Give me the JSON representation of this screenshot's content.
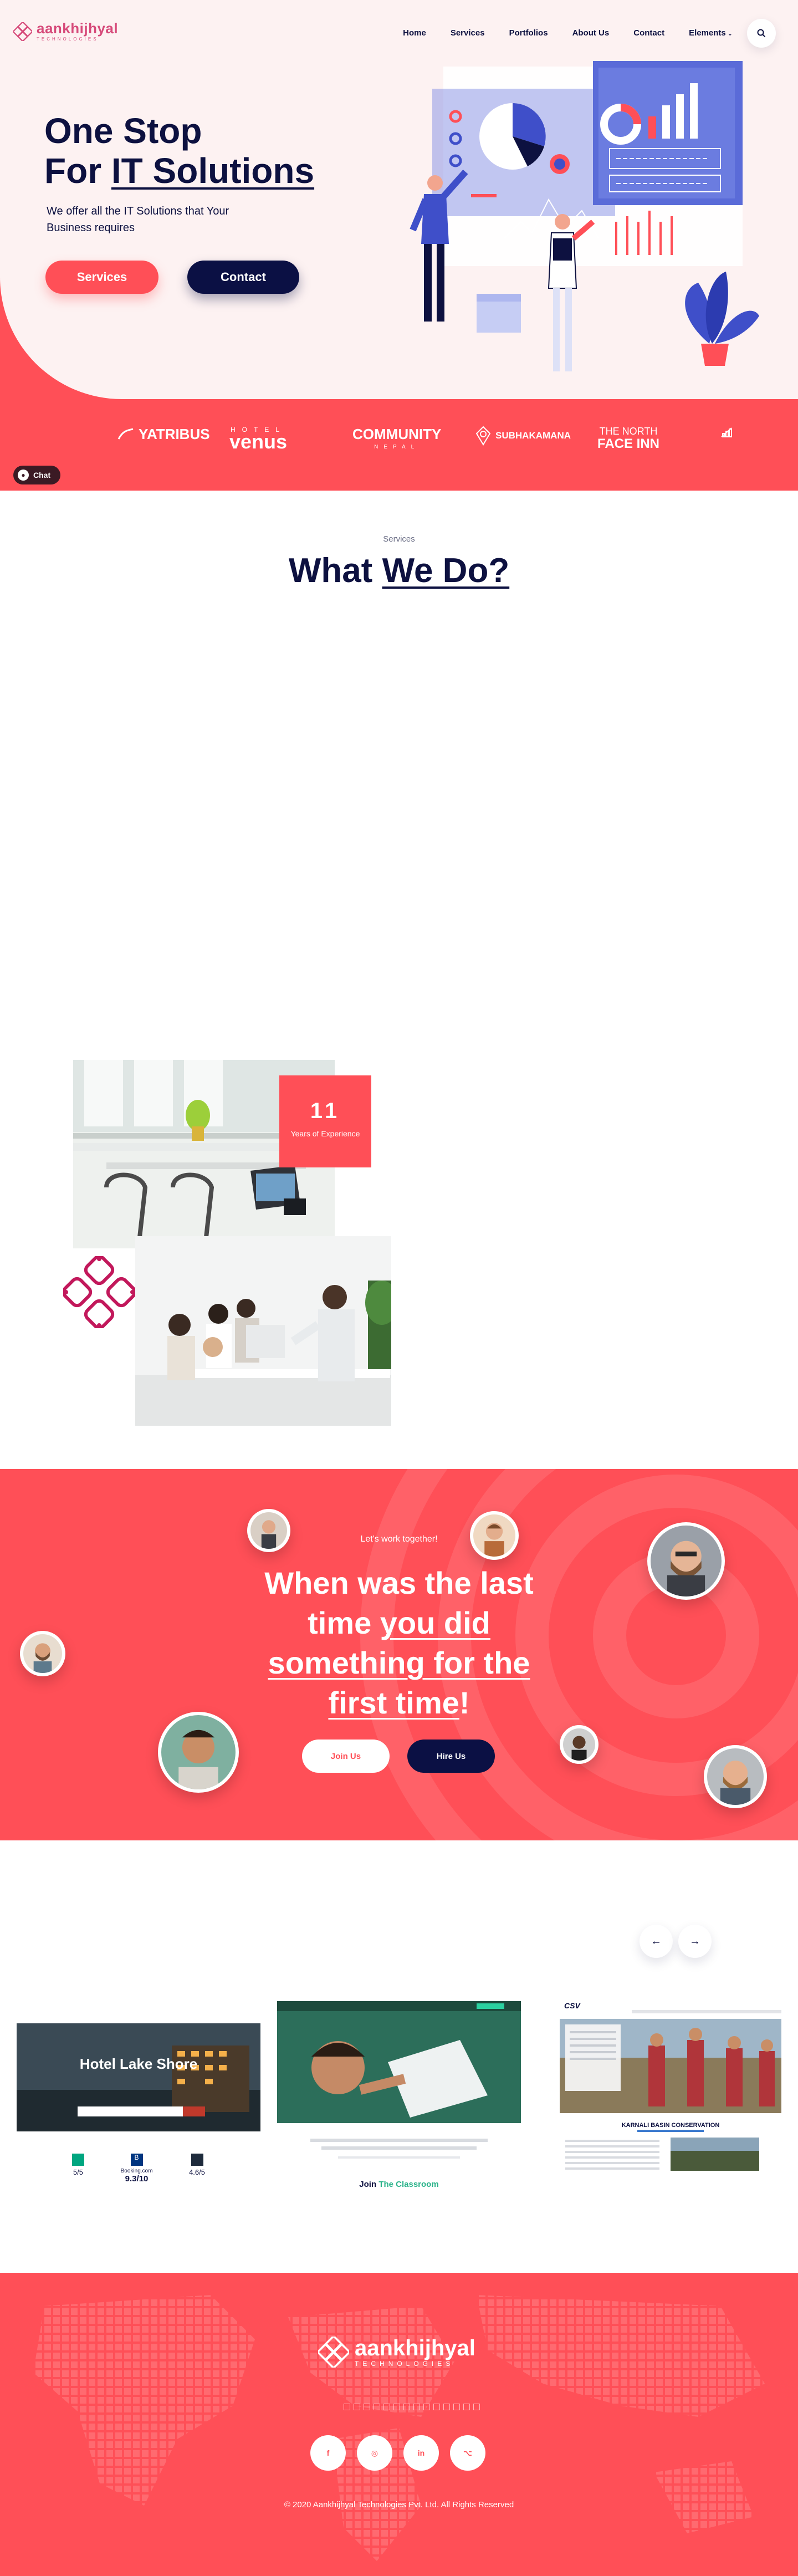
{
  "brand": {
    "name": "aankhijhyal",
    "tagline": "TECHNOLOGIES",
    "colors": {
      "primary": "#ff4f57",
      "navy": "#0b1044",
      "pink": "#d64a7a",
      "hero_bg": "#fdf2f2"
    }
  },
  "nav": {
    "items": [
      "Home",
      "Services",
      "Portfolios",
      "About Us",
      "Contact",
      "Elements"
    ],
    "search_icon": "search-icon"
  },
  "hero": {
    "title_line1": "One Stop",
    "title_line2_prefix": "For ",
    "title_line2_underlined": "IT Solutions",
    "description": "We offer all the IT Solutions that Your Business requires",
    "services_button": "Services",
    "contact_button": "Contact"
  },
  "partners": [
    {
      "name": "YATRIBUS",
      "sub": ""
    },
    {
      "name": "venus",
      "sub": "HOTEL"
    },
    {
      "name": "COMMUNITY",
      "sub": "NEPAL"
    },
    {
      "name": "SUBHAKAMANA",
      "sub": ""
    },
    {
      "name": "THE NORTH",
      "sub": "FACE INN"
    }
  ],
  "chat": {
    "label": "Chat"
  },
  "services_section": {
    "tag": "Services",
    "title_prefix": "What ",
    "title_underlined": "We Do?"
  },
  "experience": {
    "number": "11",
    "label": "Years of Experience"
  },
  "cta": {
    "tag": "Let's work together!",
    "title_line1": "When was the last",
    "title_line2_prefix": "time ",
    "title_line2_underlined": "you did",
    "title_line3_underlined": "something for the",
    "title_line4_underlined": "first time",
    "title_line4_suffix": "!",
    "join_button": "Join Us",
    "hire_button": "Hire Us"
  },
  "portfolio": {
    "prev_icon": "arrow-left-icon",
    "next_icon": "arrow-right-icon",
    "cards": [
      {
        "hero_text": "Hotel Lake Shore",
        "stats": [
          {
            "label": "",
            "value": "5/5"
          },
          {
            "label": "Booking.com",
            "value": "9.3/10"
          },
          {
            "label": "",
            "value": "4.6/5"
          }
        ]
      },
      {
        "join_prefix": "Join ",
        "join_highlight": "The Classroom"
      },
      {
        "site_logo": "CSV",
        "heading": "KARNALI BASIN CONSERVATION"
      }
    ]
  },
  "footer": {
    "name": "aankhijhyal",
    "tagline": "TECHNOLOGIES",
    "social_icons": [
      "facebook-icon",
      "instagram-icon",
      "linkedin-icon",
      "github-icon"
    ],
    "social_labels": [
      "f",
      "◎",
      "in",
      "⌥"
    ],
    "copyright": "© 2020 Aankhijhyal Technologies Pvt. Ltd. All Rights Reserved"
  }
}
